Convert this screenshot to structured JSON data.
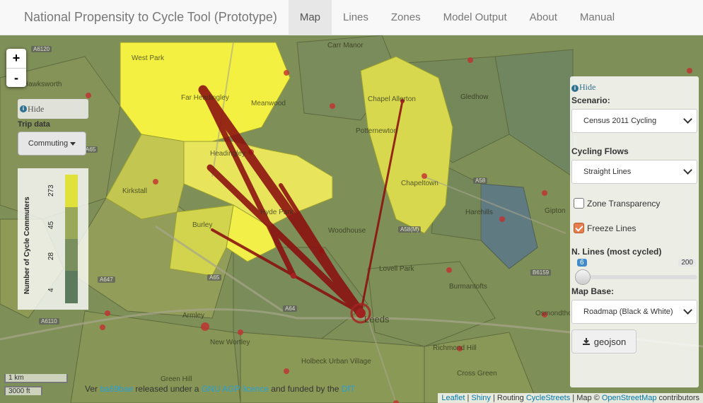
{
  "navbar": {
    "brand": "National Propensity to Cycle Tool (Prototype)",
    "items": [
      {
        "label": "Map",
        "active": true
      },
      {
        "label": "Lines",
        "active": false
      },
      {
        "label": "Zones",
        "active": false
      },
      {
        "label": "Model Output",
        "active": false
      },
      {
        "label": "About",
        "active": false
      },
      {
        "label": "Manual",
        "active": false
      }
    ]
  },
  "map": {
    "zoom_in": "+",
    "zoom_out": "-",
    "place_labels": [
      "West Park",
      "Hawksworth",
      "Far Headingley",
      "Meanwood",
      "Chapel Allerton",
      "Potternewton",
      "Gledhow",
      "Headingley",
      "Kirkstall",
      "Hyde Park",
      "Chapeltown",
      "Harehills",
      "Gipton",
      "Burley",
      "Woodhouse",
      "Lovell Park",
      "Burmantofts",
      "Armley",
      "Leeds",
      "Osmondthorpe",
      "New Wortley",
      "Richmond Hill",
      "Holbeck Urban Village",
      "Cross Green",
      "Carr Manor",
      "Green Hill"
    ],
    "road_labels": [
      "A6120",
      "A65",
      "A58",
      "A61",
      "A64",
      "A647",
      "A6110",
      "A58(M)",
      "B6159"
    ],
    "scale_km": "1 km",
    "scale_ft": "3000 ft",
    "credit": {
      "prefix": "Ver",
      "link1": "ba69bae",
      "middle": " released under a ",
      "link2": "GNU AGP licence",
      "suffix": " and funded by the ",
      "link3": "DfT"
    },
    "attribution": {
      "leaflet": "Leaflet",
      "sep1": " | ",
      "shiny": "Shiny",
      "routing": " | Routing ",
      "cyclestreets": "CycleStreets",
      "map": " | Map © ",
      "osm": "OpenStreetMap",
      "contributors": " contributors"
    }
  },
  "left_panel": {
    "hide_label": "Hide",
    "trip_data_label": "Trip data",
    "trip_data_value": "Commuting",
    "legend_title": "Number of Cycle Commuters",
    "legend_ticks": [
      "273",
      "45",
      "28",
      "4"
    ],
    "legend_colors": [
      "#e0e13a",
      "#9aa85a",
      "#7a8f5e",
      "#5c7a5e"
    ]
  },
  "right_panel": {
    "hide_label": "Hide",
    "scenario_label": "Scenario:",
    "scenario_value": "Census 2011 Cycling",
    "flows_label": "Cycling Flows",
    "flows_value": "Straight Lines",
    "zone_transparency_label": "Zone Transparency",
    "zone_transparency_checked": false,
    "freeze_lines_label": "Freeze Lines",
    "freeze_lines_checked": true,
    "nlines_label": "N. Lines (most cycled)",
    "nlines_value": "6",
    "nlines_max": "200",
    "map_base_label": "Map Base:",
    "map_base_value": "Roadmap (Black & White)",
    "geojson_label": "geojson"
  }
}
